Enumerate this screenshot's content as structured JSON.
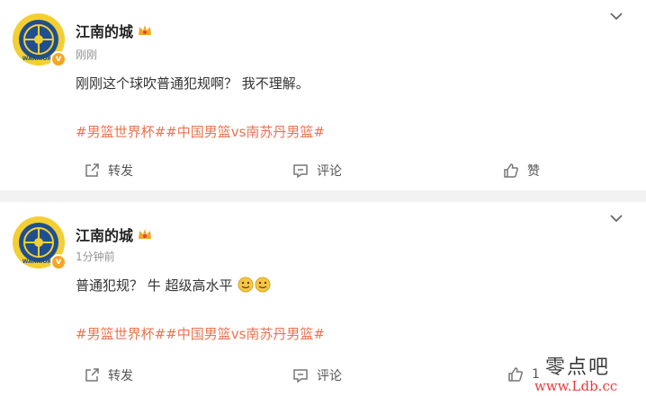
{
  "posts": [
    {
      "username": "江南的城",
      "time": "刚刚",
      "text": "刚刚这个球吹普通犯规啊？  我不理解。",
      "tags": "#男篮世界杯##中国男篮vs南苏丹男篮#",
      "actions": {
        "forward": "转发",
        "comment": "评论",
        "like": "赞"
      }
    },
    {
      "username": "江南的城",
      "time": "1分钟前",
      "text": "普通犯规？  牛    超级高水平",
      "tags": "#男篮世界杯##中国男篮vs南苏丹男篮#",
      "actions": {
        "forward": "转发",
        "comment": "评论",
        "like": "1"
      }
    }
  ],
  "avatar_text": "WARRIORS",
  "verified_badge": "v",
  "watermark": {
    "cn": "零点吧",
    "url": "www.Ldb.cc"
  },
  "colors": {
    "accent_tag": "#eb7350",
    "badge": "#f6a623",
    "avatar_bg": "#f3cf34",
    "page_bg": "#f2f2f2"
  }
}
